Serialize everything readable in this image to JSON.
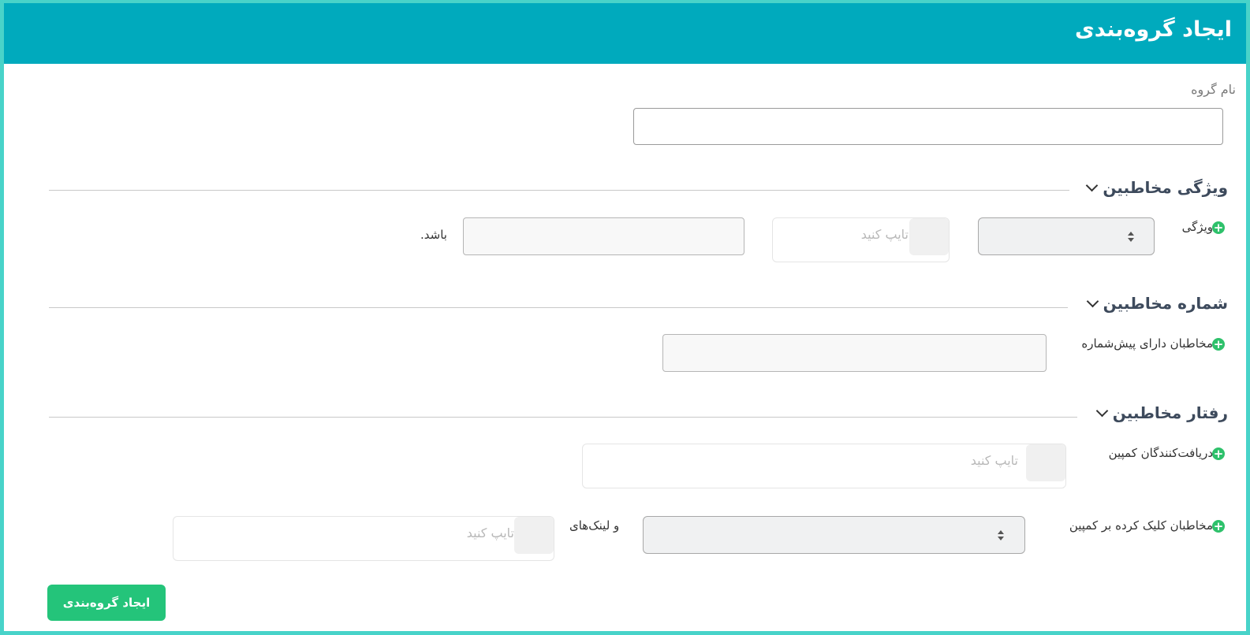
{
  "header": {
    "title": "ایجاد گروه‌بندی"
  },
  "group_name": {
    "label": "نام گروه",
    "value": ""
  },
  "sections": {
    "feature": {
      "title": "ویژگی مخاطبین",
      "row": {
        "label": "ویژگی",
        "select_value": "",
        "tag_placeholder": "تایپ کنید",
        "value": "",
        "suffix": "باشد."
      }
    },
    "number": {
      "title": "شماره مخاطبین",
      "row": {
        "label": "مخاطبان دارای پیش‌شماره",
        "value": ""
      }
    },
    "behavior": {
      "title": "رفتار مخاطبین",
      "recipients": {
        "label": "دریافت‌کنندگان کمپین",
        "placeholder": "تایپ کنید"
      },
      "clicked": {
        "label": "مخاطبان کلیک کرده بر کمپین",
        "select_value": "",
        "links_label": "و لینک‌های",
        "placeholder": "تایپ کنید"
      }
    }
  },
  "submit_label": "ایجاد گروه‌بندی",
  "colors": {
    "header": "#00aabd",
    "frame": "#48d3c9",
    "accent_green": "#24c47a",
    "plus_green": "#2ec16b"
  },
  "icons": {
    "section_toggle": "chevron-down-icon",
    "add": "plus-circle-icon",
    "select_arrows": "sort-arrows-icon"
  }
}
